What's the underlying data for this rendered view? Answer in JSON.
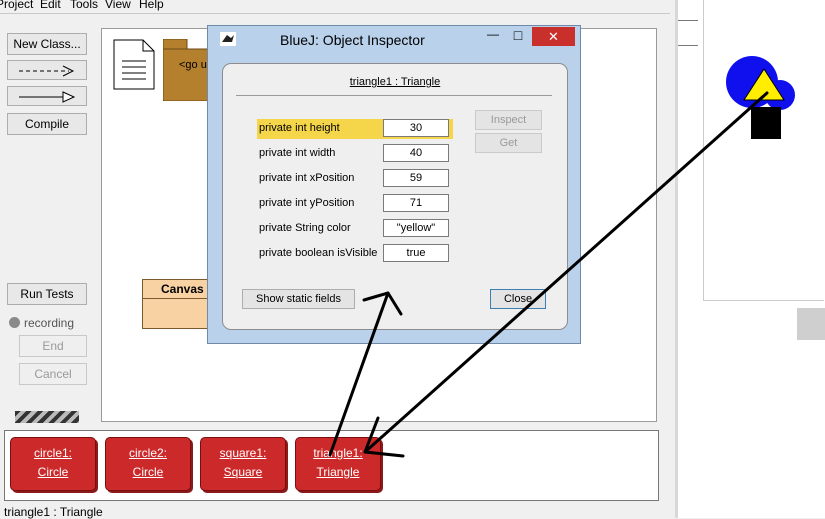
{
  "menu": [
    "Project",
    "Edit",
    "Tools",
    "View",
    "Help"
  ],
  "left_buttons": {
    "new_class": "New Class...",
    "compile": "Compile",
    "run_tests": "Run Tests",
    "recording": "recording",
    "end": "End",
    "cancel": "Cancel"
  },
  "diagram": {
    "package_label": "<go u",
    "class_label": "Canvas"
  },
  "bench": {
    "objects": [
      {
        "name": "circle1:",
        "type": "Circle"
      },
      {
        "name": "circle2:",
        "type": "Circle"
      },
      {
        "name": "square1:",
        "type": "Square"
      },
      {
        "name": "triangle1:",
        "type": "Triangle"
      }
    ]
  },
  "inspector": {
    "window_title": "BlueJ:  Object Inspector",
    "header": "triangle1 : Triangle",
    "fields": [
      {
        "name": "private int height",
        "value": "30"
      },
      {
        "name": "private int width",
        "value": "40"
      },
      {
        "name": "private int xPosition",
        "value": "59"
      },
      {
        "name": "private int yPosition",
        "value": "71"
      },
      {
        "name": "private String color",
        "value": "\"yellow\""
      },
      {
        "name": "private boolean isVisible",
        "value": "true"
      }
    ],
    "inspect_label": "Inspect",
    "get_label": "Get",
    "show_static_label": "Show static fields",
    "close_label": "Close",
    "window_buttons": {
      "minimize": "—",
      "maximize": "□",
      "close": "✕"
    }
  },
  "status_text": "triangle1 : Triangle",
  "colors": {
    "object_red": "#cc2a2a",
    "selected_field": "#f5d64a",
    "dialog_frame": "#b9d1ea",
    "close_red": "#c9302c",
    "shape_blue": "#1010ee",
    "shape_yellow": "#ffee00"
  }
}
